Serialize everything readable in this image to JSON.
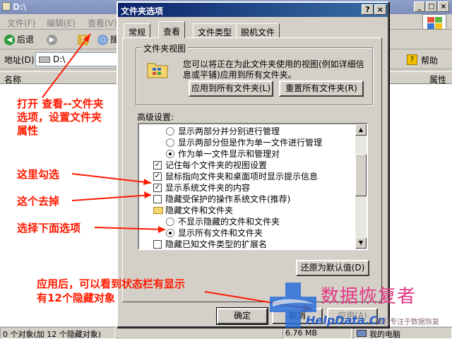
{
  "explorer": {
    "title": "D:\\",
    "title_controls": [
      "_",
      "□",
      "×"
    ],
    "menu": [
      "文件(F)",
      "编辑(E)",
      "查看(V)"
    ],
    "back_label": "后退",
    "search_label": "搜",
    "address_label": "地址(D)",
    "address_value": "D:\\",
    "help_label": "帮助",
    "columns": [
      "名称",
      "属性"
    ],
    "status": {
      "objects": "0 个对象(加 12 个隐藏对象)",
      "size": "6.76 MB",
      "location": "我的电脑"
    }
  },
  "dialog": {
    "title": "文件夹选项",
    "title_buttons": [
      "?",
      "×"
    ],
    "tabs": [
      {
        "label": "常规",
        "active": false
      },
      {
        "label": "查看",
        "active": true
      },
      {
        "label": "文件类型",
        "active": false
      },
      {
        "label": "脱机文件",
        "active": false
      }
    ],
    "folder_views": {
      "legend": "文件夹视图",
      "description": "您可以将正在为此文件夹使用的视图(例如详细信息或平铺)应用到所有文件夹。",
      "apply_all_button": "应用到所有文件夹(L)",
      "reset_all_button": "重置所有文件夹(R)"
    },
    "advanced_label": "高级设置:",
    "advanced_items": [
      {
        "type": "radio",
        "label": "显示两部分并分别进行管理",
        "checked": false,
        "indent": 2
      },
      {
        "type": "radio",
        "label": "显示两部分但是作为单一文件进行管理",
        "checked": false,
        "indent": 2
      },
      {
        "type": "radio",
        "label": "作为单一文件显示和管理对",
        "checked": true,
        "indent": 2
      },
      {
        "type": "checkbox",
        "label": "记住每个文件夹的视图设置",
        "checked": true,
        "indent": 1
      },
      {
        "type": "checkbox",
        "label": "鼠标指向文件夹和桌面项时显示提示信息",
        "checked": true,
        "indent": 1
      },
      {
        "type": "checkbox",
        "label": "显示系统文件夹的内容",
        "checked": true,
        "indent": 1
      },
      {
        "type": "checkbox",
        "label": "隐藏受保护的操作系统文件(推荐)",
        "checked": false,
        "indent": 1
      },
      {
        "type": "folder",
        "label": "隐藏文件和文件夹",
        "checked": false,
        "indent": 1
      },
      {
        "type": "radio",
        "label": "不显示隐藏的文件和文件夹",
        "checked": false,
        "indent": 2
      },
      {
        "type": "radio",
        "label": "显示所有文件和文件夹",
        "checked": true,
        "indent": 2
      },
      {
        "type": "checkbox",
        "label": "隐藏已知文件类型的扩展名",
        "checked": false,
        "indent": 1
      }
    ],
    "restore_defaults_button": "还原为默认值(D)",
    "ok_button": "确定",
    "cancel_button": "取消",
    "apply_button": "应用(A)"
  },
  "annotations": {
    "open_options": [
      "打开 查看--文件夹",
      "选项，设置文件夹",
      "属性"
    ],
    "check_here": "这里勾选",
    "uncheck_this": "这个去掉",
    "choose_below": "选择下面选项",
    "after_apply": [
      "应用后，可以看到状态栏有显示",
      "有12个隐藏对象"
    ]
  },
  "watermark": {
    "text": "数据恢复者",
    "url": "HelpData.Cn",
    "slogan": "我们专注于数据恢复"
  },
  "colors": {
    "annotation": "#ff1a00",
    "dialog_title": "#0a246a",
    "watermark_pink": "#e23a86",
    "watermark_blue": "#2a5fc8"
  }
}
